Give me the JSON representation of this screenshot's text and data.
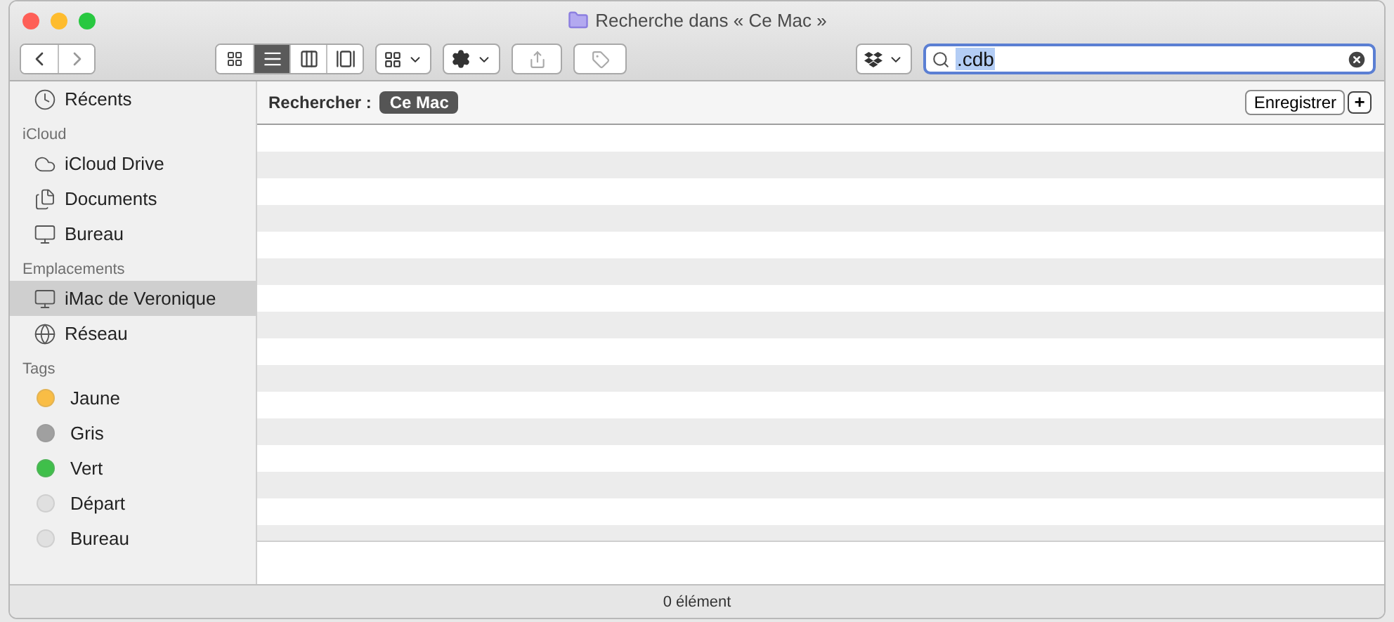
{
  "window": {
    "title": "Recherche dans « Ce Mac »"
  },
  "toolbar": {
    "views": [
      {
        "kind": "icons",
        "selected": false
      },
      {
        "kind": "list",
        "selected": true
      },
      {
        "kind": "columns",
        "selected": false
      },
      {
        "kind": "gallery",
        "selected": false
      }
    ],
    "search": {
      "value": ".cdb"
    }
  },
  "sidebar": {
    "sections": [
      {
        "items": [
          {
            "label": "Récents",
            "kind": "recents",
            "selected": false
          }
        ]
      },
      {
        "title": "iCloud",
        "items": [
          {
            "label": "iCloud Drive",
            "kind": "cloud",
            "selected": false
          },
          {
            "label": "Documents",
            "kind": "documents",
            "selected": false
          },
          {
            "label": "Bureau",
            "kind": "desktop",
            "selected": false
          }
        ]
      },
      {
        "title": "Emplacements",
        "items": [
          {
            "label": "iMac de Veronique",
            "kind": "computer",
            "selected": true
          },
          {
            "label": "Réseau",
            "kind": "network",
            "selected": false
          }
        ]
      },
      {
        "title": "Tags",
        "items": [
          {
            "label": "Jaune",
            "kind": "tag",
            "color": "#f9bd45",
            "selected": false
          },
          {
            "label": "Gris",
            "kind": "tag",
            "color": "#a0a0a0",
            "selected": false
          },
          {
            "label": "Vert",
            "kind": "tag",
            "color": "#3fbf4a",
            "selected": false
          },
          {
            "label": "Départ",
            "kind": "tag",
            "color": "#e0e0e0",
            "selected": false
          },
          {
            "label": "Bureau",
            "kind": "tag",
            "color": "#e0e0e0",
            "selected": false
          }
        ]
      }
    ]
  },
  "scope_bar": {
    "label": "Rechercher :",
    "scopes": [
      {
        "label": "Ce Mac",
        "selected": true
      }
    ],
    "save_button": "Enregistrer",
    "add_button": "+"
  },
  "status_bar": {
    "text": "0 élément"
  }
}
